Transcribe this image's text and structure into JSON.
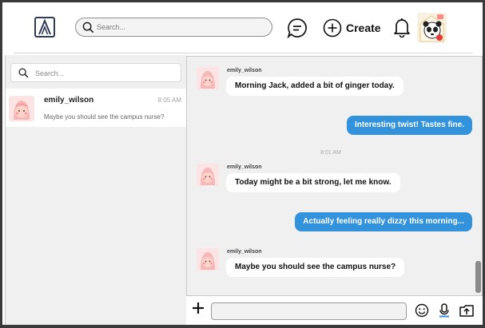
{
  "header": {
    "search_placeholder": "Search...",
    "create_label": "Create",
    "logo_icon": "brand-logo-icon",
    "messages_icon": "chat-bubble-icon",
    "notifications_icon": "bell-icon"
  },
  "sidebar": {
    "search_placeholder": "Search...",
    "conversations": [
      {
        "name": "emily_wilson",
        "time": "8:05 AM",
        "preview": "Maybe you should see the campus nurse?"
      }
    ]
  },
  "chat": {
    "messages": [
      {
        "direction": "in",
        "sender": "emily_wilson",
        "text": "Morning Jack, added a bit of ginger today."
      },
      {
        "direction": "out",
        "text": "Interesting twist! Tastes fine."
      },
      {
        "type": "time",
        "text": "8:01 AM"
      },
      {
        "direction": "in",
        "sender": "emily_wilson",
        "text": "Today might be a bit strong, let me know."
      },
      {
        "direction": "out",
        "text": "Actually feeling really dizzy this morning..."
      },
      {
        "direction": "in",
        "sender": "emily_wilson",
        "text": "Maybe you should see the campus nurse?"
      }
    ]
  },
  "composer": {
    "input_value": ""
  },
  "colors": {
    "accent": "#3392dc",
    "panel_bg": "#f0f0f0",
    "avatar_pink": "#f7c6c7"
  }
}
